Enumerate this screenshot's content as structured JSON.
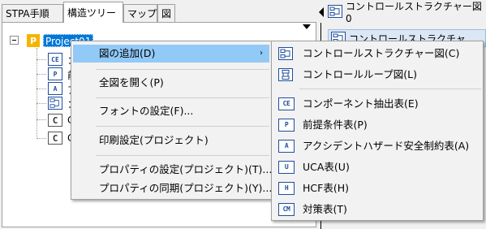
{
  "tabs": [
    {
      "label": "STPA手順"
    },
    {
      "label": "構造ツリー"
    },
    {
      "label": "マップ"
    },
    {
      "label": "図"
    }
  ],
  "tree": {
    "project_label": "Project01",
    "project_icon_text": "P",
    "nodes": [
      {
        "icon": "CE",
        "label": "コ"
      },
      {
        "icon": "P",
        "label": "前"
      },
      {
        "icon": "A",
        "label": "ア"
      },
      {
        "icon": "ctrl",
        "label": "コ"
      },
      {
        "icon": "C",
        "label": "C"
      },
      {
        "icon": "C",
        "label": "C"
      }
    ]
  },
  "right_pane": {
    "header_label": "コントロールストラクチャー図0",
    "row2_label": "コントロールストラクチャ"
  },
  "context_menu": {
    "items": [
      {
        "label": "図の追加(D)",
        "has_submenu": true,
        "highlighted": true
      },
      {
        "label": "全図を開く(P)"
      },
      {
        "label": "フォントの設定(F)..."
      },
      {
        "label": "印刷設定(プロジェクト)"
      },
      {
        "label": "プロパティの設定(プロジェクト)(T)..."
      },
      {
        "label": "プロパティの同期(プロジェクト)(Y)..."
      }
    ],
    "submenu_arrow": "›"
  },
  "submenu": {
    "items": [
      {
        "label": "コントロールストラクチャー図(C)",
        "icon": "control-structure-icon"
      },
      {
        "label": "コントロールループ図(L)",
        "icon": "control-loop-icon"
      },
      {
        "label": "コンポーネント抽出表(E)",
        "icon_text": "CE",
        "icon": "component-table-icon"
      },
      {
        "label": "前提条件表(P)",
        "icon_text": "P",
        "icon": "precondition-table-icon"
      },
      {
        "label": "アクシデントハザード安全制約表(A)",
        "icon_text": "A",
        "icon": "accident-table-icon"
      },
      {
        "label": "UCA表(U)",
        "icon_text": "U",
        "icon": "uca-table-icon"
      },
      {
        "label": "HCF表(H)",
        "icon_text": "H",
        "icon": "hcf-table-icon"
      },
      {
        "label": "対策表(T)",
        "icon_text": "CM",
        "icon": "countermeasure-table-icon"
      }
    ]
  },
  "colors": {
    "highlight": "#91c9f7",
    "selection": "#0078d7",
    "icon_blue": "#1f4e9c",
    "project_icon": "#f5b400"
  }
}
